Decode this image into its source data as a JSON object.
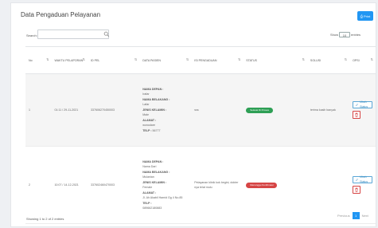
{
  "page": {
    "title": "Data Pengaduan Pelayanan"
  },
  "toolbar": {
    "print_label": "Print",
    "search_label": "Search:",
    "show_prefix": "Show",
    "show_value": "10",
    "show_suffix": "entries"
  },
  "table": {
    "columns": [
      "No",
      "WAKTU PELAPORAN",
      "ID PEL",
      "DATA PASIEN",
      "ISI PENGADUAN",
      "STATUS",
      "SOLUSI",
      "OPSI"
    ],
    "rows": [
      {
        "no": "1",
        "waktu": "01:11 / 29-11-2021",
        "id": "337606270450003",
        "nama_label": "NAMA DEPAN :",
        "nama": "Irafar",
        "belakang_label": "NAMA BELAKANG :",
        "belakang": "Lafar",
        "jk_label": "JENIS KELAMIN :",
        "jk": "Male",
        "alamat_label": "ALAMAT :",
        "alamat": "wonodare",
        "telp_label": "TELP :",
        "telp": "56777",
        "isi": "sss",
        "status": "Selesai Di Proses",
        "solusi": "terima kasih banyak",
        "action": "Ubah Status"
      },
      {
        "no": "2",
        "waktu": "10:07 / 14-12-2021",
        "id": "337602460470003",
        "nama_label": "NAMA DEPAN :",
        "nama": "Nama Dari",
        "belakang_label": "NAMA BELAKANG :",
        "belakang": "Mulanian",
        "jk_label": "JENIS KELAMIN :",
        "jk": "Female",
        "alamat_label": "ALAMAT :",
        "alamat": "Jl. Ah Akabil Hamid Gg 4 No.85",
        "telp_label": "TELP :",
        "telp": "089662180883",
        "isi": "Pelayanan klinik kok begini, dokter nya telat mulu",
        "status": "Menunggu Konfirmasi",
        "solusi": "",
        "action": "Ubah Status"
      }
    ]
  },
  "footer": {
    "info": "Showing 1 to 2 of 2 entries",
    "prev": "Previous",
    "page": "1",
    "next": "Next"
  },
  "colors": {
    "primary": "#2196f3",
    "success": "#2e9f55",
    "danger": "#d64545"
  }
}
